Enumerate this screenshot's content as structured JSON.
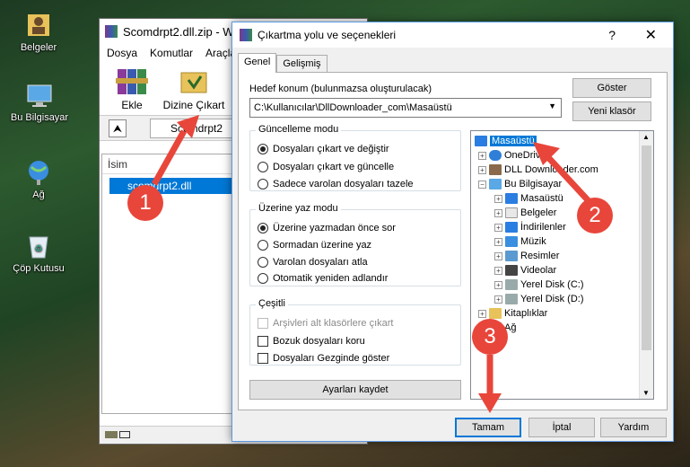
{
  "desktop": {
    "icons": [
      {
        "label": "Belgeler"
      },
      {
        "label": "Bu Bilgisayar"
      },
      {
        "label": "Ağ"
      },
      {
        "label": "Çöp Kutusu"
      }
    ]
  },
  "background_window": {
    "title": "Scomdrpt2.dll.zip - W",
    "menu": [
      "Dosya",
      "Komutlar",
      "Araçla"
    ],
    "toolbar": {
      "add_label": "Ekle",
      "extract_to_label": "Dizine Çıkart"
    },
    "address_value": "Scomdrpt2",
    "column_header": "İsim",
    "file_name": "scomdrpt2.dll"
  },
  "dialog": {
    "title": "Çıkartma yolu ve seçenekleri",
    "tabs": [
      "Genel",
      "Gelişmiş"
    ],
    "dest_label": "Hedef konum (bulunmazsa oluşturulacak)",
    "dest_value": "C:\\Kullanıcılar\\DllDownloader_com\\Masaüstü",
    "show_button": "Göster",
    "new_folder_button": "Yeni klasör",
    "update_mode": {
      "title": "Güncelleme modu",
      "options": [
        "Dosyaları çıkart ve değiştir",
        "Dosyaları çıkart ve güncelle",
        "Sadece varolan dosyaları tazele"
      ]
    },
    "overwrite_mode": {
      "title": "Üzerine yaz modu",
      "options": [
        "Üzerine yazmadan önce sor",
        "Sormadan üzerine yaz",
        "Varolan dosyaları atla",
        "Otomatik yeniden adlandır"
      ]
    },
    "misc": {
      "title": "Çeşitli",
      "options": [
        "Arşivleri alt klasörlere çıkart",
        "Bozuk dosyaları koru",
        "Dosyaları Gezginde göster"
      ]
    },
    "save_settings_button": "Ayarları kaydet",
    "tree": [
      "Masaüstü",
      "OneDrive",
      "DLL Downloader.com",
      "Bu Bilgisayar",
      "Masaüstü",
      "Belgeler",
      "İndirilenler",
      "Müzik",
      "Resimler",
      "Videolar",
      "Yerel Disk (C:)",
      "Yerel Disk (D:)",
      "Kitaplıklar",
      "Ağ"
    ],
    "ok_button": "Tamam",
    "cancel_button": "İptal",
    "help_button": "Yardım"
  },
  "annotations": [
    "1",
    "2",
    "3"
  ],
  "colors": {
    "accent": "#0078d7",
    "arrow": "#e8463b",
    "selection": "#0078d7"
  }
}
